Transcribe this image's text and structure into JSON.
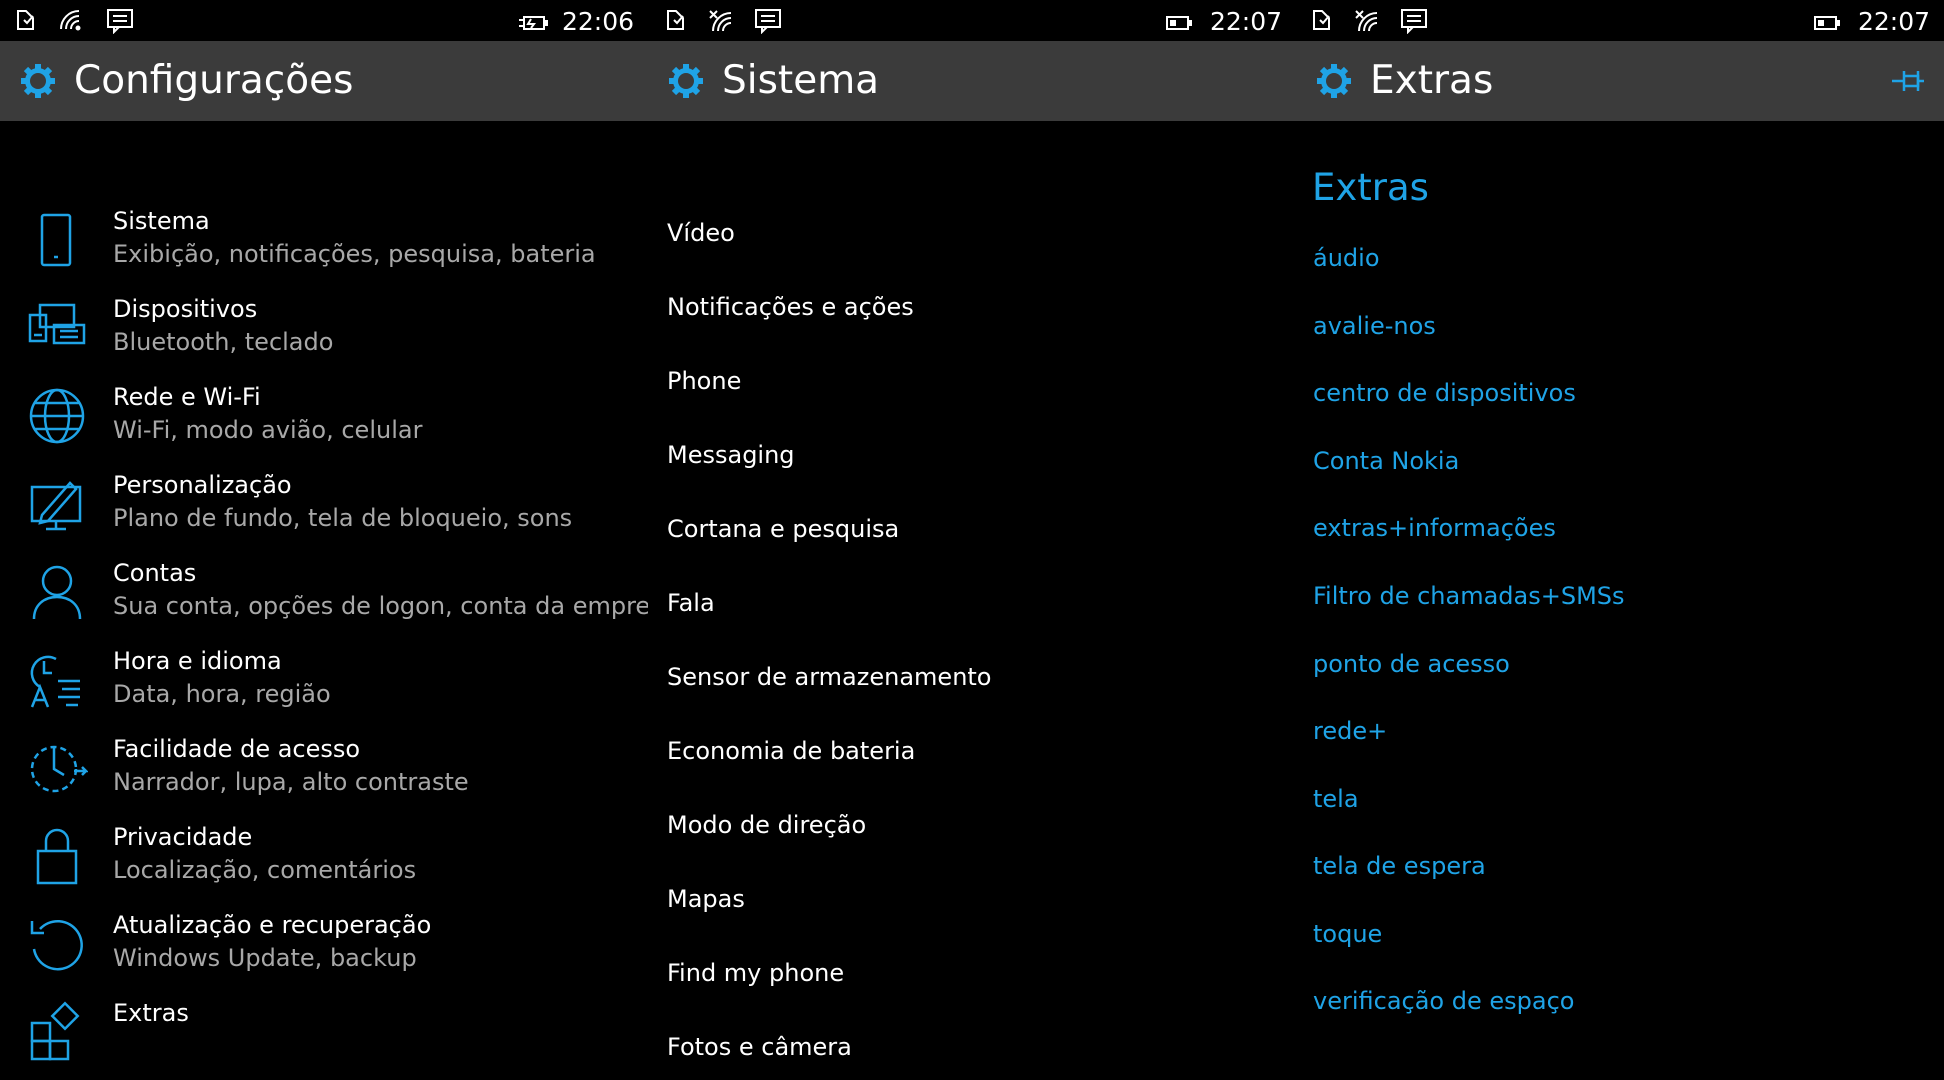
{
  "panels": {
    "configuracoes": {
      "time": "22:06",
      "title": "Configurações",
      "items": [
        {
          "title": "Sistema",
          "subtitle": "Exibição, notificações, pesquisa, bateria",
          "icon": "phone-icon"
        },
        {
          "title": "Dispositivos",
          "subtitle": "Bluetooth, teclado",
          "icon": "devices-icon"
        },
        {
          "title": "Rede e Wi-Fi",
          "subtitle": "Wi-Fi, modo avião, celular",
          "icon": "globe-icon"
        },
        {
          "title": "Personalização",
          "subtitle": "Plano de fundo, tela de bloqueio, sons",
          "icon": "paint-icon"
        },
        {
          "title": "Contas",
          "subtitle": "Sua conta, opções de logon, conta da empresa",
          "icon": "person-icon"
        },
        {
          "title": "Hora e idioma",
          "subtitle": "Data, hora, região",
          "icon": "time-language-icon"
        },
        {
          "title": "Facilidade de acesso",
          "subtitle": "Narrador, lupa, alto contraste",
          "icon": "ease-of-access-icon"
        },
        {
          "title": "Privacidade",
          "subtitle": "Localização, comentários",
          "icon": "lock-icon"
        },
        {
          "title": "Atualização e recuperação",
          "subtitle": "Windows Update, backup",
          "icon": "refresh-icon"
        },
        {
          "title": "Extras",
          "subtitle": "",
          "icon": "extras-icon"
        }
      ]
    },
    "sistema": {
      "time": "22:07",
      "title": "Sistema",
      "items": [
        "Vídeo",
        "Notificações e ações",
        "Phone",
        "Messaging",
        "Cortana e pesquisa",
        "Fala",
        "Sensor de armazenamento",
        "Economia de bateria",
        "Modo de direção",
        "Mapas",
        "Find my phone",
        "Fotos e câmera"
      ]
    },
    "extras": {
      "time": "22:07",
      "title": "Extras",
      "heading": "Extras",
      "items": [
        "áudio",
        "avalie-nos",
        "centro de dispositivos",
        "Conta Nokia",
        "extras+informações",
        "Filtro de chamadas+SMSs",
        "ponto de acesso",
        "rede+",
        "tela",
        "tela de espera",
        "toque",
        "verificação de espaço"
      ]
    }
  },
  "colors": {
    "accent": "#1fa3e6",
    "titlebar": "#3b3b3b",
    "background": "#000000",
    "subtitle": "#a8a8a8"
  }
}
